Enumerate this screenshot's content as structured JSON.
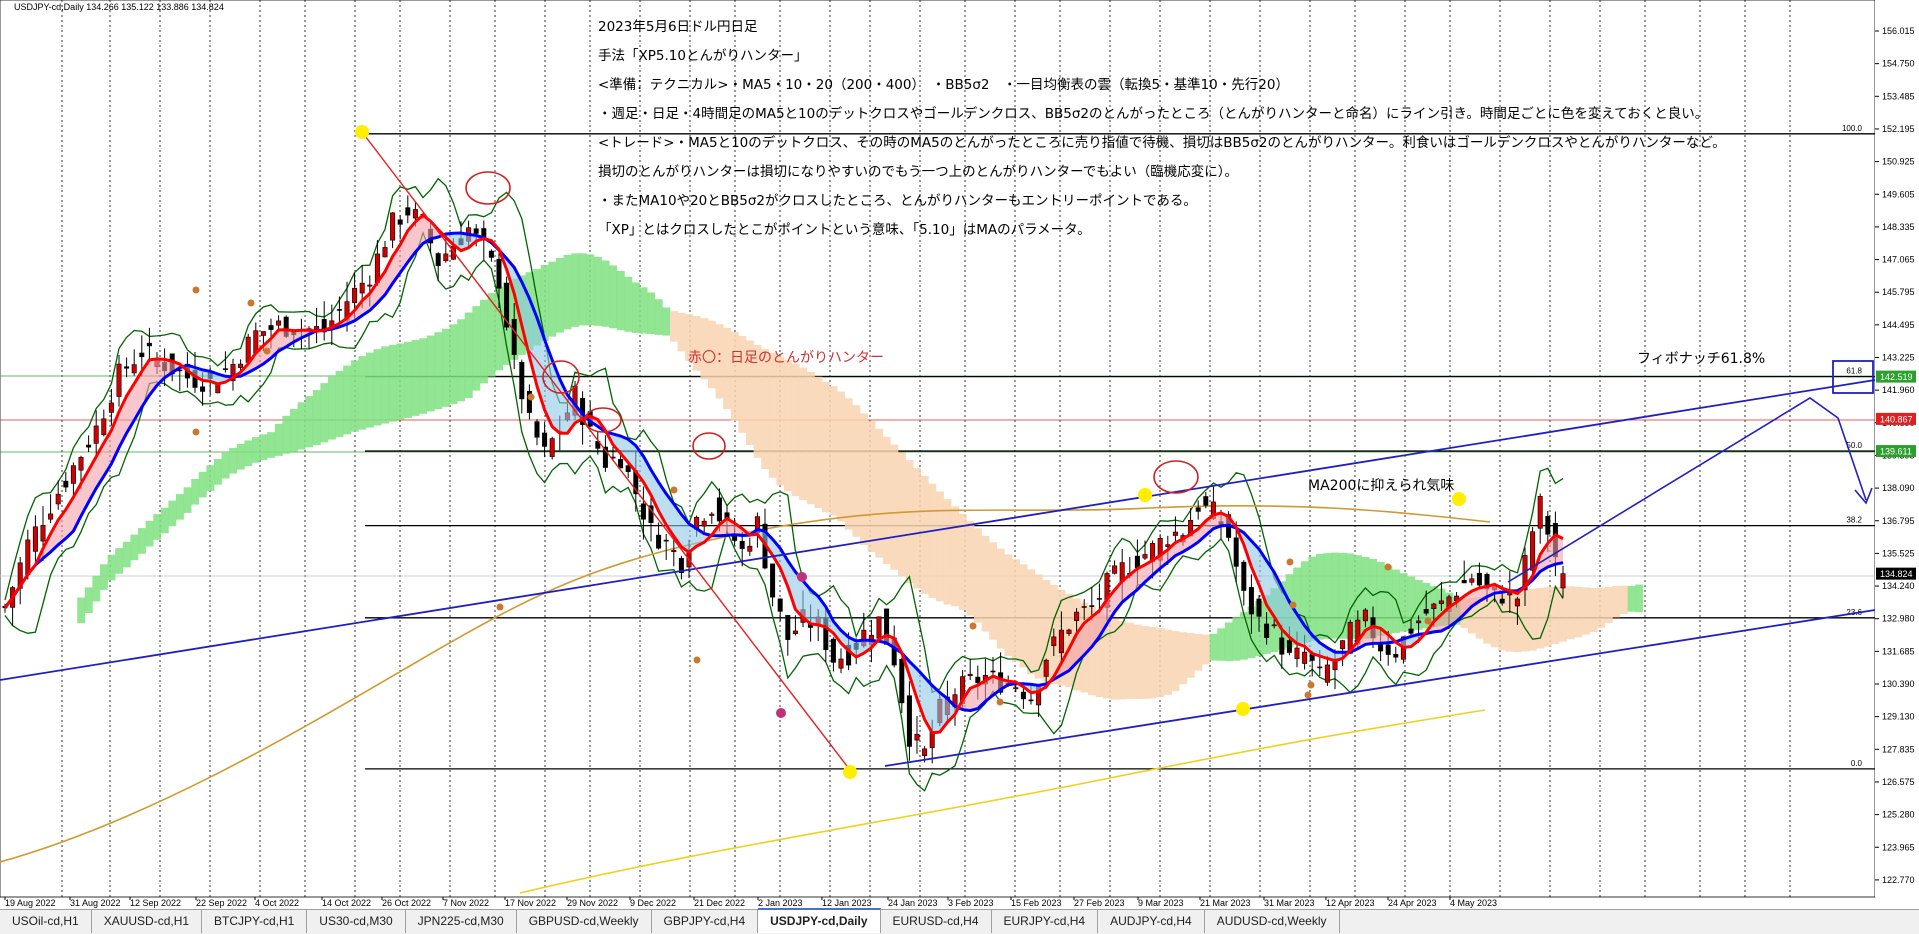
{
  "window": {
    "symbol_info": "USDJPY-cd,Daily  134.266 135.122 133.886 134.824"
  },
  "annotations": {
    "notes": [
      "2023年5月6日ドル円日足",
      "手法「XP5.10とんがりハンター」",
      "<準備：テクニカル>・MA5・10・20（200・400）　・BB5σ2　・一目均衡表の雲（転換5・基準10・先行20）",
      "・週足・日足・4時間足のMA5と10のデットクロスやゴールデンクロス、BB5σ2のとんがったところ（とんがりハンターと命名）にライン引き。時間足ごとに色を変えておくと良い。",
      "<トレード>・MA5と10のデットクロス、その時のMA5のとんがったところに売り指値で待機、損切はBB5σ2のとんがりハンター。利食いはゴールデンクロスやとんがりハンターなど。",
      "損切のとんがりハンターは損切になりやすいのでもう一つ上のとんがりハンターでもよい（臨機応変に）。",
      "・またMA10や20とBB5σ2がクロスしたところ、とんがりハンターもエントリーポイントである。",
      "「XP」とはクロスしたとこがポイントという意味、「5.10」はMAのパラメータ。"
    ],
    "red_circle_label": "赤〇：日足のとんがりハンター",
    "ma200_label": "MA200に抑えられ気味",
    "fib_label": "フィボナッチ61.8%"
  },
  "fibonacci": {
    "levels": [
      {
        "label": "100.0",
        "price": 152.0
      },
      {
        "label": "61.8",
        "price": 142.519
      },
      {
        "label": "50.0",
        "price": 139.611
      },
      {
        "label": "38.2",
        "price": 136.7
      },
      {
        "label": "23.6",
        "price": 133.1
      },
      {
        "label": "0.0",
        "price": 127.2
      }
    ]
  },
  "price_tags": {
    "current": "134.824",
    "level_618": "142.519",
    "red_line": "140.867",
    "level_50": "139.611"
  },
  "colors": {
    "candle": "#000000",
    "up_fill": "#d00000",
    "ma5": "#ff0000",
    "ma10": "#0000ff",
    "bb": "#006400",
    "cloud_bull": "#7fe07f",
    "cloud_bear": "#f9d3b0",
    "ma200": "#d09a30",
    "ma400": "#f0d020",
    "channel": "#2020c0",
    "fib": "#000000",
    "red_annot": "#d03030"
  },
  "chart_data": {
    "type": "candlestick",
    "symbol": "USDJPY-cd",
    "timeframe": "Daily",
    "last": {
      "open": 134.266,
      "high": 135.122,
      "low": 133.886,
      "close": 134.824
    },
    "y_ticks": [
      "156.015",
      "154.750",
      "153.485",
      "152.195",
      "150.925",
      "149.605",
      "148.335",
      "147.065",
      "145.795",
      "144.495",
      "143.225",
      "141.960",
      "140.690",
      "139.395",
      "138.090",
      "136.795",
      "135.525",
      "134.240",
      "132.980",
      "131.685",
      "130.390",
      "129.130",
      "127.835",
      "126.575",
      "125.280",
      "123.965",
      "122.770"
    ],
    "ylim": [
      122.77,
      156.5
    ],
    "x_ticks": [
      "19 Aug 2022",
      "31 Aug 2022",
      "12 Sep 2022",
      "22 Sep 2022",
      "4 Oct 2022",
      "14 Oct 2022",
      "26 Oct 2022",
      "7 Nov 2022",
      "17 Nov 2022",
      "29 Nov 2022",
      "9 Dec 2022",
      "21 Dec 2022",
      "2 Jan 2023",
      "12 Jan 2023",
      "24 Jan 2023",
      "3 Feb 2023",
      "15 Feb 2023",
      "27 Feb 2023",
      "9 Mar 2023",
      "21 Mar 2023",
      "31 Mar 2023",
      "12 Apr 2023",
      "24 Apr 2023",
      "4 May 2023"
    ],
    "close_path": [
      [
        0,
        133.5
      ],
      [
        3,
        136
      ],
      [
        6,
        137.5
      ],
      [
        9,
        139
      ],
      [
        12,
        140.5
      ],
      [
        15,
        142.6
      ],
      [
        18,
        143.5
      ],
      [
        21,
        143
      ],
      [
        24,
        142.5
      ],
      [
        27,
        142.3
      ],
      [
        30,
        143
      ],
      [
        33,
        144.2
      ],
      [
        36,
        144.5
      ],
      [
        39,
        144.4
      ],
      [
        42,
        144.3
      ],
      [
        45,
        145.5
      ],
      [
        48,
        146.5
      ],
      [
        51,
        148.5
      ],
      [
        53,
        149
      ],
      [
        55,
        148.5
      ],
      [
        57,
        147
      ],
      [
        59,
        147.7
      ],
      [
        61,
        148.3
      ],
      [
        63,
        147.5
      ],
      [
        65,
        146.3
      ],
      [
        67,
        143
      ],
      [
        69,
        140.7
      ],
      [
        71,
        139.5
      ],
      [
        73,
        140.5
      ],
      [
        75,
        141.8
      ],
      [
        77,
        140.3
      ],
      [
        79,
        139.2
      ],
      [
        81,
        139.4
      ],
      [
        83,
        138
      ],
      [
        85,
        136.5
      ],
      [
        87,
        136
      ],
      [
        89,
        135.3
      ],
      [
        91,
        137
      ],
      [
        93,
        137.5
      ],
      [
        95,
        136.6
      ],
      [
        97,
        135.7
      ],
      [
        99,
        136.8
      ],
      [
        101,
        134
      ],
      [
        103,
        132.3
      ],
      [
        105,
        133
      ],
      [
        107,
        132.8
      ],
      [
        109,
        131.5
      ],
      [
        111,
        131.7
      ],
      [
        113,
        132.5
      ],
      [
        115,
        133
      ],
      [
        117,
        131.5
      ],
      [
        119,
        128.5
      ],
      [
        121,
        127.8
      ],
      [
        123,
        129.5
      ],
      [
        125,
        130.2
      ],
      [
        127,
        130.6
      ],
      [
        129,
        130.8
      ],
      [
        131,
        130.6
      ],
      [
        133,
        130.5
      ],
      [
        135,
        130
      ],
      [
        137,
        131.6
      ],
      [
        139,
        132.5
      ],
      [
        141,
        133.2
      ],
      [
        143,
        133.5
      ],
      [
        145,
        134.4
      ],
      [
        147,
        135
      ],
      [
        149,
        135.4
      ],
      [
        151,
        135.8
      ],
      [
        153,
        136.3
      ],
      [
        155,
        136.5
      ],
      [
        157,
        137.5
      ],
      [
        159,
        137.2
      ],
      [
        161,
        136.3
      ],
      [
        163,
        133.9
      ],
      [
        165,
        133
      ],
      [
        167,
        132.5
      ],
      [
        169,
        131.5
      ],
      [
        171,
        131.7
      ],
      [
        173,
        130.8
      ],
      [
        175,
        131.5
      ],
      [
        177,
        132.5
      ],
      [
        179,
        133
      ],
      [
        181,
        132
      ],
      [
        183,
        131.8
      ],
      [
        185,
        132.7
      ],
      [
        187,
        133.3
      ],
      [
        189,
        133.6
      ],
      [
        191,
        134.2
      ],
      [
        193,
        134.7
      ],
      [
        195,
        134.1
      ],
      [
        197,
        134
      ],
      [
        199,
        133.9
      ],
      [
        201,
        136.5
      ],
      [
        202,
        137.5
      ],
      [
        203,
        136.5
      ],
      [
        204,
        135.5
      ],
      [
        205,
        134.8
      ]
    ],
    "series": [
      {
        "name": "MA5"
      },
      {
        "name": "MA10"
      },
      {
        "name": "BB5σ2"
      },
      {
        "name": "一目均衡表の雲"
      },
      {
        "name": "MA200"
      },
      {
        "name": "MA400"
      }
    ]
  }
}
